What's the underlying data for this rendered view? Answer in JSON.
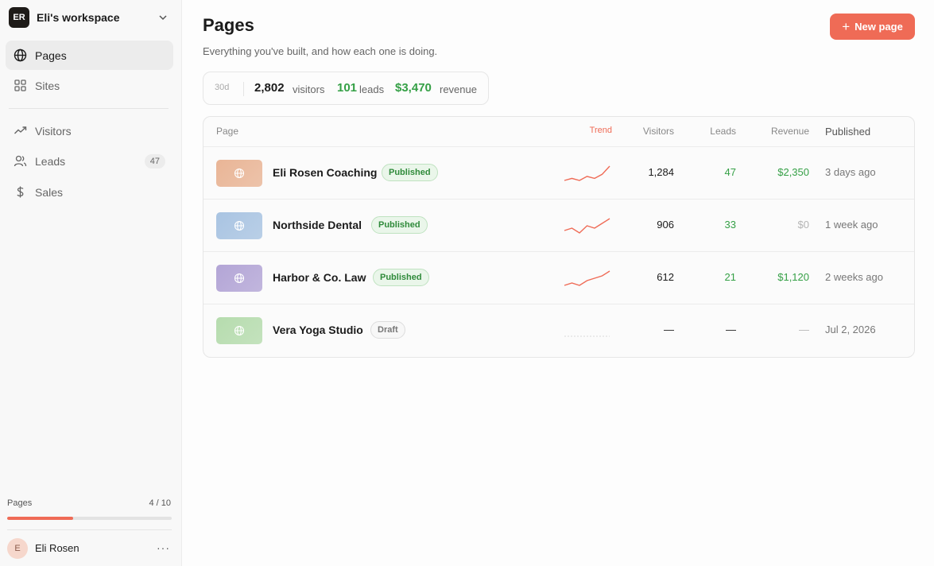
{
  "workspace": {
    "initials": "ER",
    "name": "Eli's workspace"
  },
  "nav": {
    "pages": "Pages",
    "sites": "Sites",
    "visitors": "Visitors",
    "leads": "Leads",
    "leads_badge": "47",
    "sales": "Sales"
  },
  "quota": {
    "label": "Pages",
    "count": "4 / 10",
    "fraction": 0.4,
    "color": "#ef6b56"
  },
  "user": {
    "initial": "E",
    "name": "Eli Rosen",
    "more": "···"
  },
  "header": {
    "title": "Pages",
    "subtitle": "Everything you've built, and how each one is doing.",
    "new_button": "New page",
    "new_button_icon": "+"
  },
  "stats": {
    "period": "30d",
    "visitors_value": "2,802",
    "visitors_label": "visitors",
    "leads_value": "101",
    "leads_label": "leads",
    "revenue_value": "$3,470",
    "revenue_label": "revenue"
  },
  "table": {
    "columns": {
      "page": "Page",
      "trend": "Trend",
      "visitors": "Visitors",
      "leads": "Leads",
      "revenue": "Revenue",
      "published": "Published"
    },
    "rows": [
      {
        "name": "Eli Rosen Coaching",
        "status": "Published",
        "visitors": "1,284",
        "leads": "47",
        "revenue": "$2,350",
        "published": "3 days ago",
        "thumb_color": "#e9b596",
        "trend": [
          3,
          4,
          3,
          5,
          4,
          6,
          10
        ]
      },
      {
        "name": "Northside Dental",
        "status": "Published",
        "visitors": "906",
        "leads": "33",
        "revenue": "$0",
        "published": "1 week ago",
        "thumb_color": "#a9c4e2",
        "trend": [
          4,
          5,
          3,
          6,
          5,
          7,
          9
        ]
      },
      {
        "name": "Harbor & Co. Law",
        "status": "Published",
        "visitors": "612",
        "leads": "21",
        "revenue": "$1,120",
        "published": "2 weeks ago",
        "thumb_color": "#b3a5d6",
        "trend": [
          3,
          4,
          3,
          5,
          6,
          7,
          9
        ]
      },
      {
        "name": "Vera Yoga Studio",
        "status": "Draft",
        "visitors": "—",
        "leads": "—",
        "revenue": "—",
        "published": "Jul 2, 2026",
        "thumb_color": "#b6dcae",
        "trend": []
      }
    ]
  },
  "colors": {
    "accent": "#ef6b56",
    "positive": "#35a046"
  },
  "icons": {
    "workspace": "chevron-down-icon",
    "pages": "globe-icon",
    "sites": "grid-icon",
    "visitors": "trend-icon",
    "leads": "users-icon",
    "sales": "dollar-icon"
  }
}
